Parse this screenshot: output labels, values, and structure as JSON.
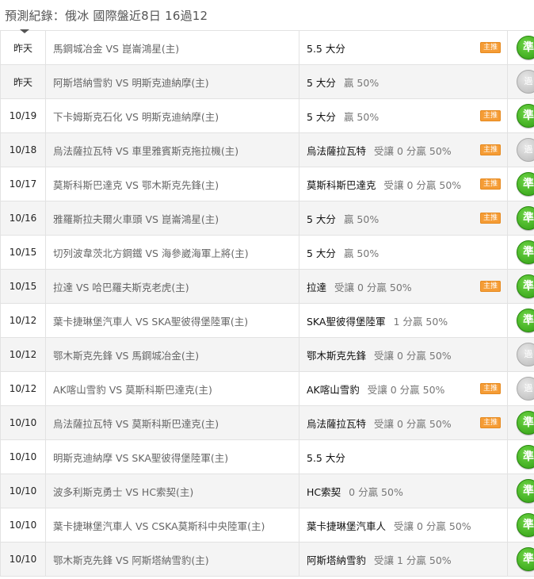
{
  "header": {
    "title": "預測紀錄：俄冰 國際盤近8日 16過12"
  },
  "rows": [
    {
      "date": "昨天",
      "match": "馬鋼城冶金 VS 崑崙鴻星(主)",
      "pick": "5.5 大分",
      "odds": "",
      "badge": "主推",
      "result": "準",
      "result_type": "win"
    },
    {
      "date": "昨天",
      "match": "阿斯塔納雪豹 VS 明斯克迪納摩(主)",
      "pick": "5 大分",
      "odds": "贏 50%",
      "badge": "",
      "result": "過",
      "result_type": "draw"
    },
    {
      "date": "10/19",
      "match": "下卡姆斯克石化 VS 明斯克迪納摩(主)",
      "pick": "5 大分",
      "odds": "贏 50%",
      "badge": "主推",
      "result": "準",
      "result_type": "win"
    },
    {
      "date": "10/18",
      "match": "烏法薩拉瓦特 VS 車里雅賓斯克拖拉機(主)",
      "pick": "烏法薩拉瓦特",
      "odds": "受讓 0 分贏 50%",
      "badge": "主推",
      "result": "過",
      "result_type": "draw"
    },
    {
      "date": "10/17",
      "match": "莫斯科斯巴達克 VS 鄂木斯克先鋒(主)",
      "pick": "莫斯科斯巴達克",
      "odds": "受讓 0 分贏 50%",
      "badge": "主推",
      "result": "準",
      "result_type": "win"
    },
    {
      "date": "10/16",
      "match": "雅羅斯拉夫爾火車頭 VS 崑崙鴻星(主)",
      "pick": "5 大分",
      "odds": "贏 50%",
      "badge": "主推",
      "result": "準",
      "result_type": "win"
    },
    {
      "date": "10/15",
      "match": "切列波韋茨北方鋼鐵 VS 海參崴海軍上將(主)",
      "pick": "5 大分",
      "odds": "贏 50%",
      "badge": "",
      "result": "準",
      "result_type": "win"
    },
    {
      "date": "10/15",
      "match": "拉達 VS 哈巴羅夫斯克老虎(主)",
      "pick": "拉達",
      "odds": "受讓 0 分贏 50%",
      "badge": "主推",
      "result": "準",
      "result_type": "win"
    },
    {
      "date": "10/12",
      "match": "葉卡捷琳堡汽車人 VS SKA聖彼得堡陸軍(主)",
      "pick": "SKA聖彼得堡陸軍",
      "odds": "1 分贏 50%",
      "badge": "",
      "result": "準",
      "result_type": "win"
    },
    {
      "date": "10/12",
      "match": "鄂木斯克先鋒 VS 馬鋼城冶金(主)",
      "pick": "鄂木斯克先鋒",
      "odds": "受讓 0 分贏 50%",
      "badge": "",
      "result": "過",
      "result_type": "draw"
    },
    {
      "date": "10/12",
      "match": "AK喀山雪豹 VS 莫斯科斯巴達克(主)",
      "pick": "AK喀山雪豹",
      "odds": "受讓 0 分贏 50%",
      "badge": "主推",
      "result": "過",
      "result_type": "draw"
    },
    {
      "date": "10/10",
      "match": "烏法薩拉瓦特 VS 莫斯科斯巴達克(主)",
      "pick": "烏法薩拉瓦特",
      "odds": "受讓 0 分贏 50%",
      "badge": "主推",
      "result": "準",
      "result_type": "win"
    },
    {
      "date": "10/10",
      "match": "明斯克迪納摩 VS SKA聖彼得堡陸軍(主)",
      "pick": "5.5 大分",
      "odds": "",
      "badge": "",
      "result": "準",
      "result_type": "win"
    },
    {
      "date": "10/10",
      "match": "波多利斯克勇士 VS HC索契(主)",
      "pick": "HC索契",
      "odds": "0 分贏 50%",
      "badge": "",
      "result": "準",
      "result_type": "win"
    },
    {
      "date": "10/10",
      "match": "葉卡捷琳堡汽車人 VS CSKA莫斯科中央陸軍(主)",
      "pick": "葉卡捷琳堡汽車人",
      "odds": "受讓 0 分贏 50%",
      "badge": "",
      "result": "準",
      "result_type": "win"
    },
    {
      "date": "10/10",
      "match": "鄂木斯克先鋒 VS 阿斯塔納雪豹(主)",
      "pick": "阿斯塔納雪豹",
      "odds": "受讓 1 分贏 50%",
      "badge": "",
      "result": "準",
      "result_type": "win"
    }
  ],
  "colors": {
    "win": "#3aaa1a",
    "draw": "#c4c4c4",
    "badge": "#f59c35",
    "alt_row": "#f4f4f4"
  }
}
